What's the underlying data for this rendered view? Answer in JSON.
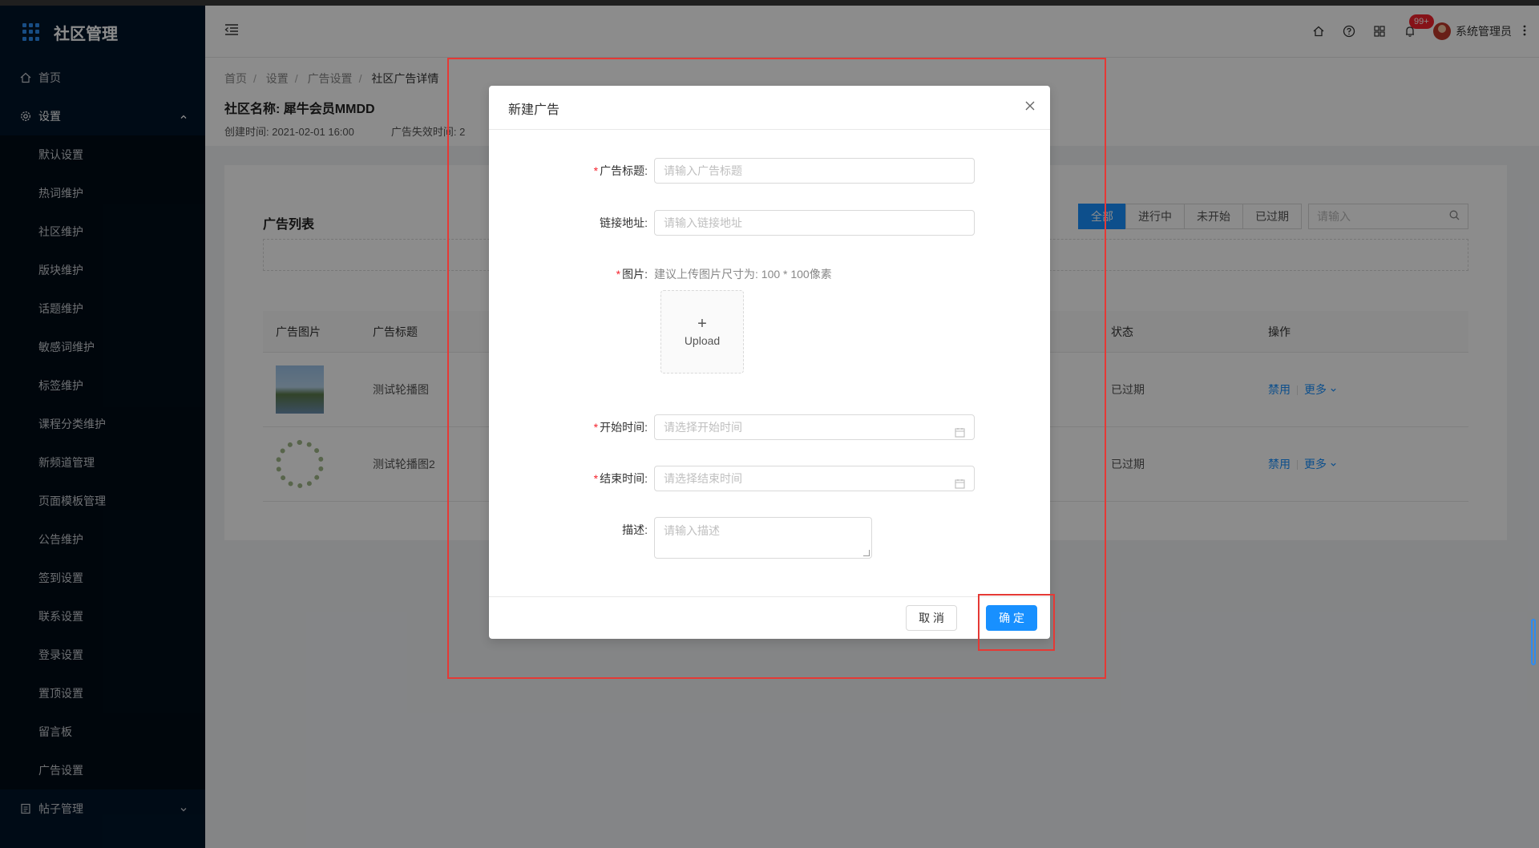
{
  "app": {
    "title": "社区管理"
  },
  "sidebar": {
    "home": "首页",
    "settings": "设置",
    "items": [
      "默认设置",
      "热词维护",
      "社区维护",
      "版块维护",
      "话题维护",
      "敏感词维护",
      "标签维护",
      "课程分类维护",
      "新频道管理",
      "页面模板管理",
      "公告维护",
      "签到设置",
      "联系设置",
      "登录设置",
      "置顶设置",
      "留言板",
      "广告设置"
    ],
    "posts": "帖子管理"
  },
  "header": {
    "badge": "99+",
    "username": "系统管理员"
  },
  "breadcrumb": {
    "items": [
      "首页",
      "设置",
      "广告设置"
    ],
    "current": "社区广告详情"
  },
  "page": {
    "community_label": "社区名称:",
    "community_name": "犀牛会员MMDD",
    "created": "创建时间: 2021-02-01 16:00",
    "expire": "广告失效时间: 2"
  },
  "list": {
    "title": "广告列表",
    "filters": [
      "全部",
      "进行中",
      "未开始",
      "已过期"
    ],
    "search_placeholder": "请输入",
    "columns": {
      "image": "广告图片",
      "title": "广告标题",
      "status": "状态",
      "ops": "操作"
    },
    "rows": [
      {
        "title": "测试轮播图",
        "status": "已过期",
        "op1": "禁用",
        "op2": "更多"
      },
      {
        "title": "测试轮播图2",
        "status": "已过期",
        "op1": "禁用",
        "op2": "更多"
      }
    ]
  },
  "modal": {
    "title": "新建广告",
    "fields": {
      "ad_title": {
        "label": "广告标题:",
        "placeholder": "请输入广告标题"
      },
      "link": {
        "label": "链接地址:",
        "placeholder": "请输入链接地址"
      },
      "image": {
        "label": "图片:",
        "hint": "建议上传图片尺寸为: 100 * 100像素",
        "upload": "Upload",
        "plus": "+"
      },
      "start": {
        "label": "开始时间:",
        "placeholder": "请选择开始时间"
      },
      "end": {
        "label": "结束时间:",
        "placeholder": "请选择结束时间"
      },
      "desc": {
        "label": "描述:",
        "placeholder": "请输入描述"
      }
    },
    "required_mark": "*",
    "cancel": "取 消",
    "ok": "确 定"
  },
  "colors": {
    "primary": "#1890ff",
    "sidebar": "#001529",
    "annotation": "#e53935"
  }
}
